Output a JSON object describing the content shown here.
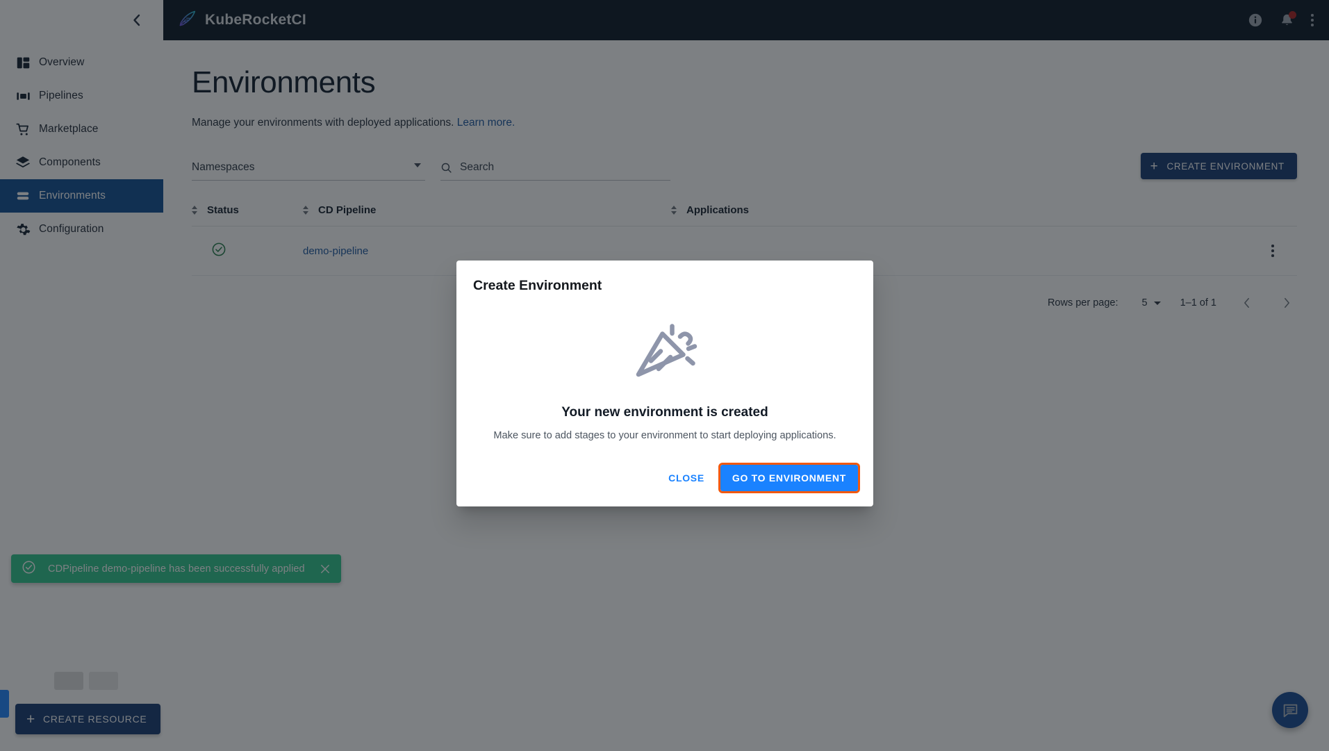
{
  "topbar": {
    "brand": "KubeRocketCI",
    "logo_icon": "rocket-feather-icon",
    "info_icon": "info-icon",
    "notifications_icon": "bell-icon",
    "overflow_icon": "more-vertical-icon",
    "notification_badge_color": "#a81b1b"
  },
  "sidebar": {
    "collapse_icon": "chevron-left-icon",
    "items": [
      {
        "label": "Overview",
        "icon": "dashboard-icon",
        "active": false
      },
      {
        "label": "Pipelines",
        "icon": "pipelines-icon",
        "active": false
      },
      {
        "label": "Marketplace",
        "icon": "cart-icon",
        "active": false
      },
      {
        "label": "Components",
        "icon": "layers-icon",
        "active": false
      },
      {
        "label": "Environments",
        "icon": "environments-icon",
        "active": true
      },
      {
        "label": "Configuration",
        "icon": "gear-icon",
        "active": false
      }
    ],
    "create_resource_label": "CREATE RESOURCE",
    "create_resource_icon": "plus-icon"
  },
  "main": {
    "title": "Environments",
    "description": "Manage your environments with deployed applications.",
    "learn_more": "Learn more.",
    "filters": {
      "namespaces_label": "Namespaces",
      "namespaces_value": "",
      "search_placeholder": "Search",
      "search_value": "",
      "search_icon": "search-icon",
      "dropdown_icon": "chevron-down-icon"
    },
    "create_environment_label": "CREATE ENVIRONMENT",
    "create_environment_icon": "plus-icon",
    "table": {
      "columns": [
        "Status",
        "CD Pipeline",
        "Applications"
      ],
      "sortable": [
        true,
        true,
        true
      ],
      "rows": [
        {
          "status": "ok",
          "status_icon": "check-circle-icon",
          "status_color": "#1f7a45",
          "cd_pipeline": "demo-pipeline",
          "applications": "",
          "row_menu_icon": "more-vertical-icon"
        }
      ]
    },
    "pagination": {
      "rows_per_page_label": "Rows per page:",
      "rows_per_page_value": "5",
      "range_label": "1–1 of 1",
      "prev_icon": "chevron-left-icon",
      "next_icon": "chevron-right-icon"
    }
  },
  "modal": {
    "title": "Create Environment",
    "illustration_icon": "party-popper-icon",
    "heading": "Your new environment is created",
    "message": "Make sure to add stages to your environment to start deploying applications.",
    "close_label": "CLOSE",
    "primary_label": "GO TO ENVIRONMENT",
    "primary_color": "#1a82ff",
    "highlight_color": "#f2590d"
  },
  "toast": {
    "message": "CDPipeline demo-pipeline has been successfully applied",
    "icon": "check-circle-icon",
    "close_icon": "close-icon",
    "background": "#2bc38a"
  },
  "fab": {
    "icon": "chat-bubble-icon",
    "color": "#11458f"
  }
}
